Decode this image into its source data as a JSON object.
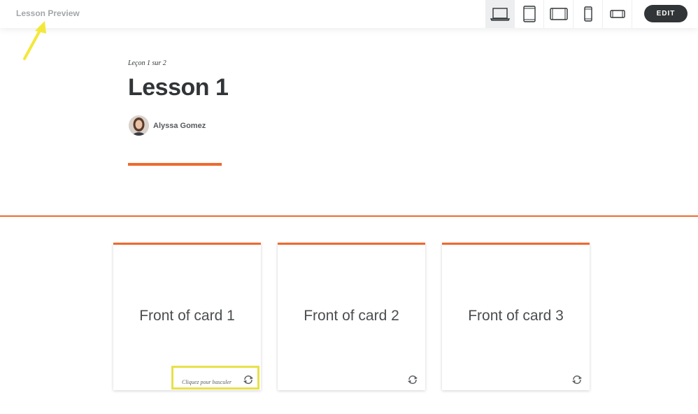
{
  "topbar": {
    "title": "Lesson Preview",
    "devices": [
      {
        "icon": "laptop-icon",
        "active": true
      },
      {
        "icon": "tablet-portrait-icon",
        "active": false
      },
      {
        "icon": "tablet-landscape-icon",
        "active": false
      },
      {
        "icon": "phone-portrait-icon",
        "active": false
      },
      {
        "icon": "phone-landscape-icon",
        "active": false
      }
    ],
    "edit_label": "EDIT"
  },
  "lesson": {
    "count_label": "Leçon 1 sur 2",
    "title": "Lesson 1",
    "author": "Alyssa Gomez"
  },
  "cards": [
    {
      "front_text": "Front of card 1",
      "flip_hint": "Cliquez pour basculer"
    },
    {
      "front_text": "Front of card 2"
    },
    {
      "front_text": "Front of card 3"
    }
  ],
  "colors": {
    "accent": "#ee6a2d",
    "annotation": "#f3e83a"
  }
}
